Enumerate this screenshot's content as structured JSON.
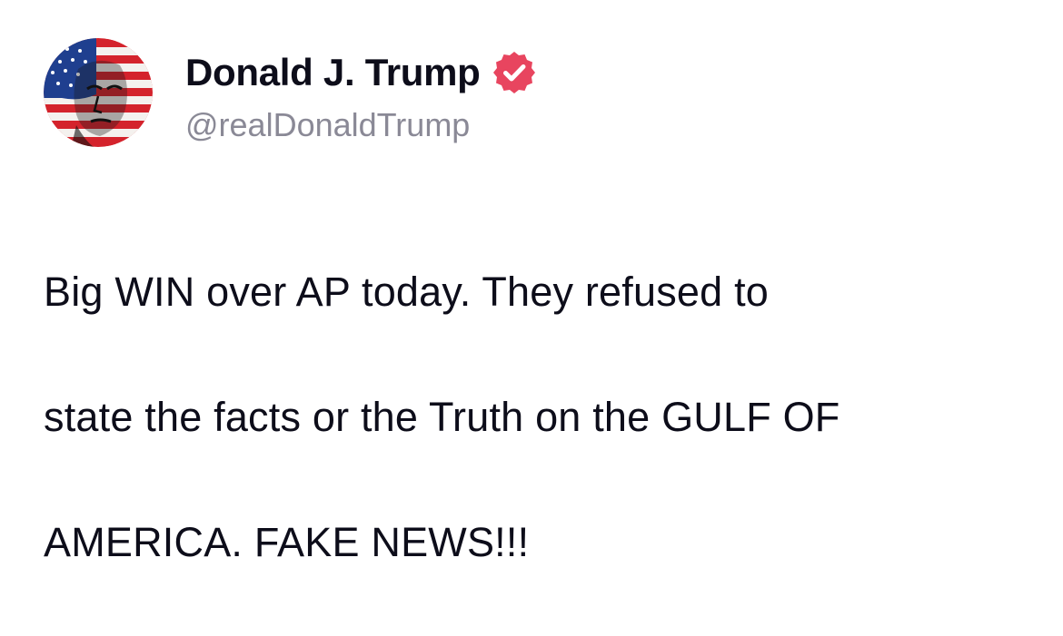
{
  "post": {
    "author": {
      "display_name": "Donald J. Trump",
      "handle": "@realDonaldTrump",
      "verified": true,
      "avatar_icon": "flag-portrait-avatar"
    },
    "body_lines": [
      "Big WIN over AP today. They refused to",
      "state the facts or the Truth on the GULF OF",
      "AMERICA. FAKE NEWS!!!"
    ]
  },
  "colors": {
    "background": "#ffffff",
    "text_primary": "#0d0d1a",
    "text_secondary": "#8a8996",
    "verified_badge": "#e8455f"
  },
  "icons": {
    "verified": "verified-badge-icon"
  }
}
